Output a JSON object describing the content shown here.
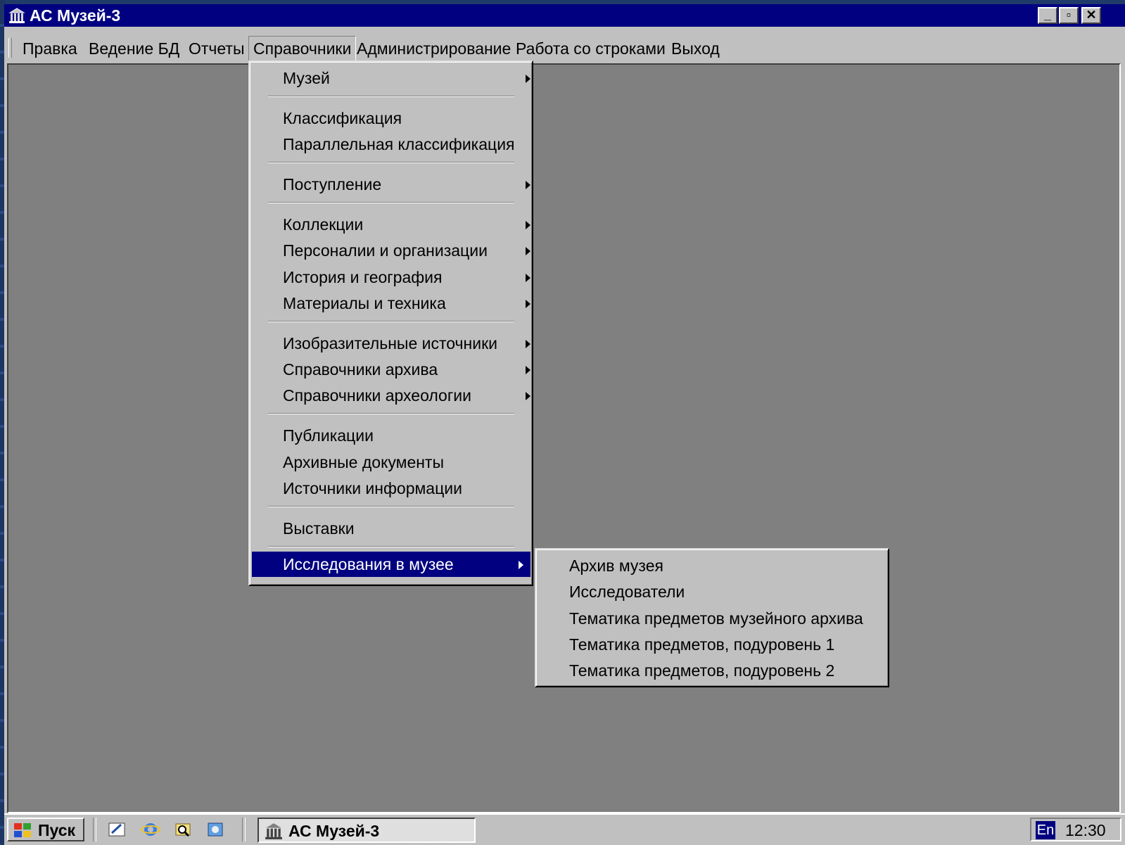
{
  "window": {
    "title": "АС Музей-3",
    "controls": {
      "minimize": "_",
      "maximize": "▫",
      "close": "✕"
    }
  },
  "menubar": {
    "items": [
      "Правка",
      "Ведение БД",
      "Отчеты",
      "Справочники",
      "Администрирование",
      "Работа со строками",
      "Выход"
    ],
    "open_item": "Справочники"
  },
  "dropdown": {
    "items": [
      "Музей",
      "Классификация",
      "Параллельная классификация",
      "Поступление",
      "Коллекции",
      "Персоналии и организации",
      "История и география",
      "Материалы и техника",
      "Изобразительные источники",
      "Справочники архива",
      "Справочники археологии",
      "Публикации",
      "Архивные документы",
      "Источники информации",
      "Выставки",
      "Исследования в музее"
    ],
    "submenu_flags": [
      true,
      false,
      false,
      true,
      true,
      true,
      true,
      true,
      true,
      true,
      true,
      false,
      false,
      false,
      false,
      true
    ],
    "highlighted": "Исследования в музее"
  },
  "submenu": {
    "items": [
      "Архив музея",
      "Исследователи",
      "Тематика предметов музейного архива",
      "Тематика предметов, подуровень 1",
      "Тематика предметов, подуровень 2"
    ]
  },
  "taskbar": {
    "start_label": "Пуск",
    "task_label": "АС Музей-3",
    "language": "En",
    "clock": "12:30"
  },
  "colors": {
    "titlebar": "#000080",
    "highlight": "#000080",
    "face": "#c0c0c0",
    "workspace": "#808080"
  }
}
